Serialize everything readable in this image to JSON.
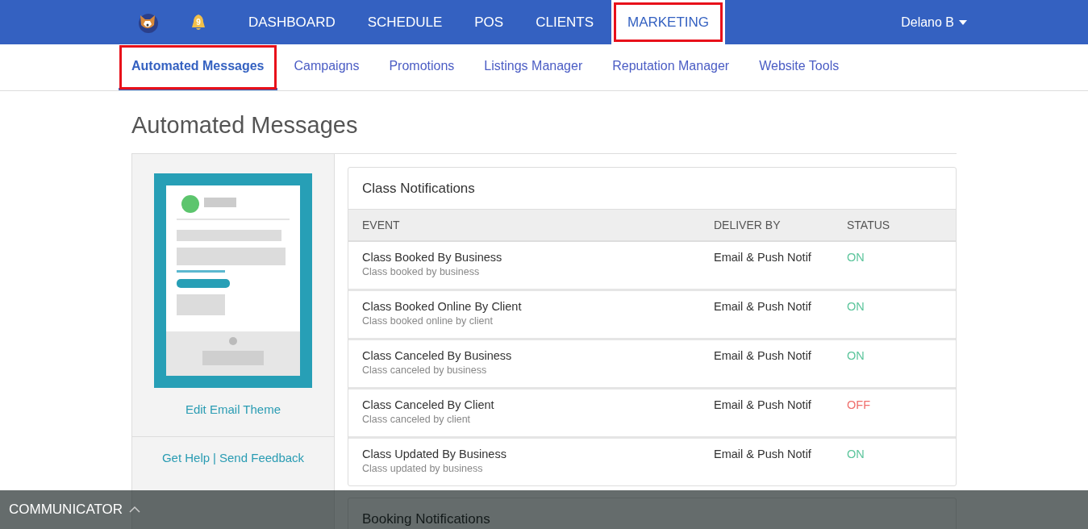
{
  "top_nav": {
    "notification_count": "9",
    "items": [
      {
        "label": "DASHBOARD",
        "selected": false,
        "highlighted": false
      },
      {
        "label": "SCHEDULE",
        "selected": false,
        "highlighted": false
      },
      {
        "label": "POS",
        "selected": false,
        "highlighted": false
      },
      {
        "label": "CLIENTS",
        "selected": false,
        "highlighted": false
      },
      {
        "label": "MARKETING",
        "selected": true,
        "highlighted": true
      }
    ],
    "user": "Delano B"
  },
  "sub_nav": [
    {
      "label": "Automated Messages",
      "selected": true,
      "highlighted": true
    },
    {
      "label": "Campaigns",
      "selected": false,
      "highlighted": false
    },
    {
      "label": "Promotions",
      "selected": false,
      "highlighted": false
    },
    {
      "label": "Listings Manager",
      "selected": false,
      "highlighted": false
    },
    {
      "label": "Reputation Manager",
      "selected": false,
      "highlighted": false
    },
    {
      "label": "Website Tools",
      "selected": false,
      "highlighted": false
    }
  ],
  "page_title": "Automated Messages",
  "sidebar": {
    "edit_link": "Edit Email Theme",
    "help_link": "Get Help",
    "separator": "|",
    "feedback_link": "Send Feedback"
  },
  "cards": [
    {
      "title": "Class Notifications",
      "columns": [
        "EVENT",
        "DELIVER BY",
        "STATUS"
      ],
      "rows": [
        {
          "event": "Class Booked By Business",
          "description": "Class booked by business",
          "deliver_by": "Email & Push Notif",
          "status": "ON",
          "on": true
        },
        {
          "event": "Class Booked Online By Client",
          "description": "Class booked online by client",
          "deliver_by": "Email & Push Notif",
          "status": "ON",
          "on": true
        },
        {
          "event": "Class Canceled By Business",
          "description": "Class canceled by business",
          "deliver_by": "Email & Push Notif",
          "status": "ON",
          "on": true
        },
        {
          "event": "Class Canceled By Client",
          "description": "Class canceled by client",
          "deliver_by": "Email & Push Notif",
          "status": "OFF",
          "on": false
        },
        {
          "event": "Class Updated By Business",
          "description": "Class updated by business",
          "deliver_by": "Email & Push Notif",
          "status": "ON",
          "on": true
        }
      ]
    },
    {
      "title": "Booking Notifications"
    }
  ],
  "communicator": {
    "label": "COMMUNICATOR",
    "expanded": false
  }
}
